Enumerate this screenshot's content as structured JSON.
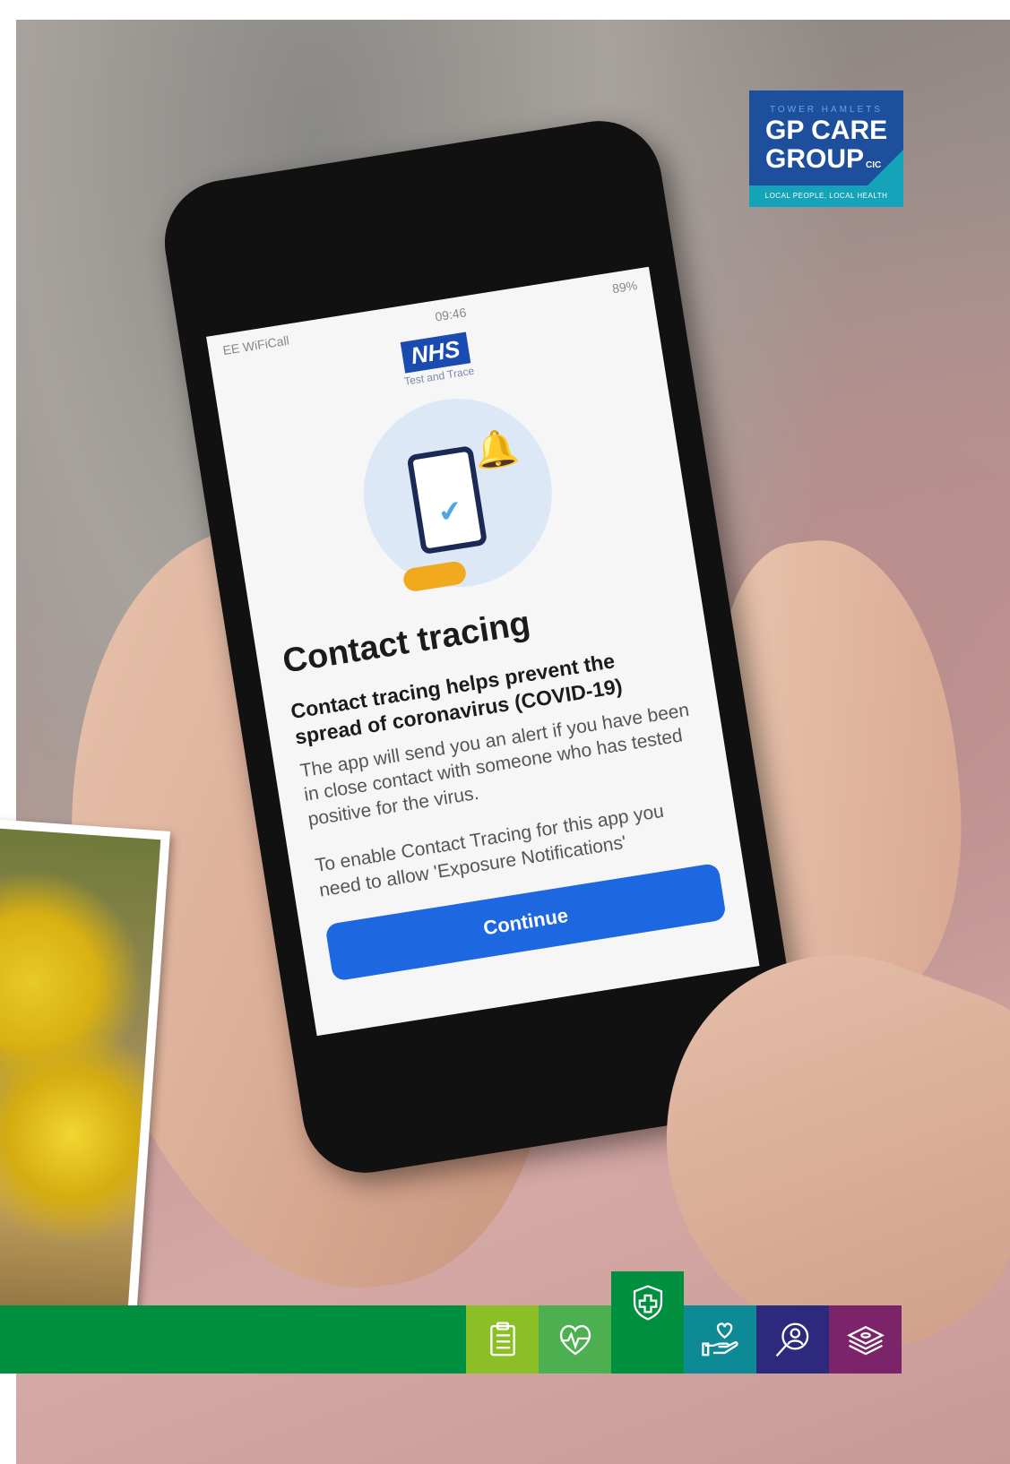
{
  "logo": {
    "top_line": "TOWER HAMLETS",
    "line1": "GP CARE",
    "line2": "GROUP",
    "suffix": "CIC",
    "tagline": "LOCAL PEOPLE, LOCAL HEALTH"
  },
  "phone": {
    "carrier": "EE WiFiCall",
    "time": "09:46",
    "battery": "89%",
    "nhs_logo": "NHS",
    "nhs_sub": "Test and Trace",
    "heading": "Contact tracing",
    "subheading": "Contact tracing helps prevent the spread of coronavirus (COVID-19)",
    "body1": "The app will send you an alert if you have been in close contact with someone who has tested positive for the virus.",
    "body2": "To enable Contact Tracing for this app you need to allow 'Exposure Notifications'",
    "button": "Continue"
  },
  "tiles": [
    {
      "icon": "clipboard-icon",
      "color": "#8cbf26"
    },
    {
      "icon": "heartbeat-icon",
      "color": "#4caf50"
    },
    {
      "icon": "shield-plus-icon",
      "color": "#008f3e"
    },
    {
      "icon": "hand-heart-icon",
      "color": "#0e8a96"
    },
    {
      "icon": "search-person-icon",
      "color": "#2d2a7d"
    },
    {
      "icon": "money-stack-icon",
      "color": "#7b2469"
    }
  ]
}
